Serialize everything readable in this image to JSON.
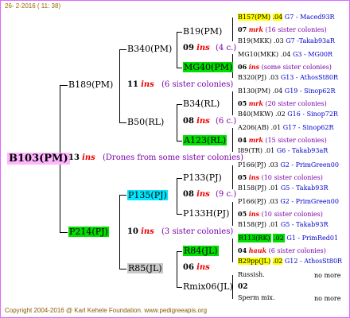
{
  "header": {
    "date": "26-  2-2016 ( 11: 38)"
  },
  "footer": {
    "copyright": "Copyright 2004-2016 @ Karl Kehele Foundation.   www.pedigreeapis.org"
  },
  "root": {
    "name": "B103(PM)",
    "count": "13",
    "ins": "ins",
    "note": "(Drones from some sister colonies)"
  },
  "sire": {
    "name": "B189(PM)",
    "count": "11",
    "ins": "ins",
    "note": "(6 sister colonies)"
  },
  "dam": {
    "name": "P214(PJ)",
    "count": "10",
    "ins": "ins",
    "note": "(3 sister colonies)"
  },
  "gen3": {
    "b340": {
      "name": "B340(PM)"
    },
    "b50": {
      "name": "B50(RL)"
    },
    "p135": {
      "name": "P135(PJ)"
    },
    "r85": {
      "name": "R85(JL)"
    }
  },
  "gen4": {
    "b19": {
      "name": "B19(PM)",
      "count": "09",
      "ins": "ins",
      "note": "(4 c.)"
    },
    "mg40": {
      "name": "MG40(PM)"
    },
    "b34": {
      "name": "B34(RL)",
      "count": "08",
      "ins": "ins",
      "note": "(6 c.)"
    },
    "a123": {
      "name": "A123(RL)"
    },
    "p133": {
      "name": "P133(PJ)",
      "count": "08",
      "ins": "ins",
      "note": "(9 c.)"
    },
    "p133h": {
      "name": "P133H(PJ)"
    },
    "r84": {
      "name": "R84(JL)",
      "count": "06",
      "ins": "ins"
    },
    "rmix": {
      "name": "Rmix06(JL)"
    }
  },
  "leaves": [
    {
      "a": "B157(PM)",
      "b": ".04",
      "c": "G7 - Maced93R"
    },
    {
      "a": "07",
      "b": "mrk",
      "c": "(16 sister colonies)"
    },
    {
      "a": "B19(MKK)",
      "b": ".03",
      "c": "G7 -Takab93aR"
    },
    {
      "a": "MG10(MKK)",
      "b": ".04",
      "c": "G3 - MG00R"
    },
    {
      "a": "06",
      "b": "ins",
      "c": "(some sister colonies)"
    },
    {
      "a": "B320(PJ)",
      "b": ".03",
      "c": "G13 - AthosSt80R"
    },
    {
      "a": "B130(PM)",
      "b": ".04",
      "c": "G19 - Sinop62R"
    },
    {
      "a": "05",
      "b": "mrk",
      "c": "(20 sister colonies)"
    },
    {
      "a": "B40(MKW)",
      "b": ".02",
      "c": "G16 - Sinop72R"
    },
    {
      "a": "A206(AB)",
      "b": ".01",
      "c": "G17 - Sinop62R"
    },
    {
      "a": "04",
      "b": "mrk",
      "c": "(15 sister colonies)"
    },
    {
      "a": "I89(TR)",
      "b": ".01",
      "c": "G6 - Takab93aR"
    },
    {
      "a": "P166(PJ)",
      "b": ".03",
      "c": "G2 - PrimGreen00"
    },
    {
      "a": "05",
      "b": "ins",
      "c": "(10 sister colonies)"
    },
    {
      "a": "B158(PJ)",
      "b": ".01",
      "c": "G5 - Takab93R"
    },
    {
      "a": "P166(PJ)",
      "b": ".03",
      "c": "G2 - PrimGreen00"
    },
    {
      "a": "05",
      "b": "ins",
      "c": "(10 sister colonies)"
    },
    {
      "a": "B158(PJ)",
      "b": ".01",
      "c": "G5 - Takab93R"
    },
    {
      "a": "R113(RK)",
      "b": ".02",
      "c": "G1 - PrimRed01"
    },
    {
      "a": "04",
      "b": "hauk",
      "c": "(6 sister colonies)"
    },
    {
      "a": "B29pp(JL)",
      "b": ".02",
      "c": "G12 - AthosSt80R"
    },
    {
      "a": "Russish.",
      "b": "",
      "c": "no more"
    },
    {
      "a": "02",
      "b": "",
      "c": ""
    },
    {
      "a": "Sperm mix.",
      "b": "",
      "c": "no more"
    }
  ]
}
